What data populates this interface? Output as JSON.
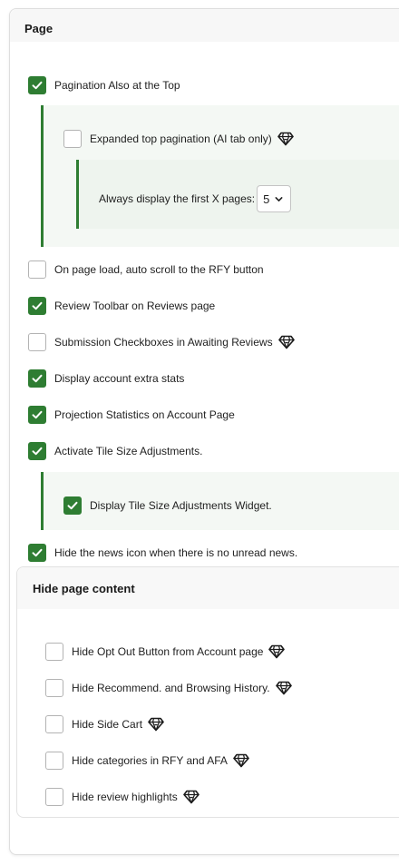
{
  "section": {
    "title": "Page"
  },
  "options": [
    {
      "label": "Pagination Also at the Top",
      "checked": true,
      "premium": false
    },
    {
      "label": "Expanded top pagination (AI tab only)",
      "checked": false,
      "premium": true
    },
    {
      "label": "On page load, auto scroll to the RFY button",
      "checked": false,
      "premium": false
    },
    {
      "label": "Review Toolbar on Reviews page",
      "checked": true,
      "premium": false
    },
    {
      "label": "Submission Checkboxes in Awaiting Reviews",
      "checked": false,
      "premium": true
    },
    {
      "label": "Display account extra stats",
      "checked": true,
      "premium": false
    },
    {
      "label": "Projection Statistics on Account Page",
      "checked": true,
      "premium": false
    },
    {
      "label": "Activate Tile Size Adjustments.",
      "checked": true,
      "premium": false
    },
    {
      "label": "Display Tile Size Adjustments Widget.",
      "checked": true,
      "premium": false
    },
    {
      "label": "Hide the news icon when there is no unread news.",
      "checked": true,
      "premium": false
    }
  ],
  "pagination_select": {
    "label": "Always display the first X pages:",
    "value": "5"
  },
  "hide_page_content": {
    "title": "Hide page content",
    "items": [
      {
        "label": "Hide Opt Out Button from Account page",
        "checked": false,
        "premium": true
      },
      {
        "label": "Hide Recommend. and Browsing History.",
        "checked": false,
        "premium": true
      },
      {
        "label": "Hide Side Cart",
        "checked": false,
        "premium": true
      },
      {
        "label": "Hide categories in RFY and AFA",
        "checked": false,
        "premium": true
      },
      {
        "label": "Hide review highlights",
        "checked": false,
        "premium": true
      }
    ]
  },
  "colors": {
    "accent": "#2e7d32",
    "indent_bg": "#f4f8f4"
  },
  "icons": {
    "check": "check-icon",
    "premium": "gem-icon",
    "dropdown": "chevron-down-icon"
  }
}
